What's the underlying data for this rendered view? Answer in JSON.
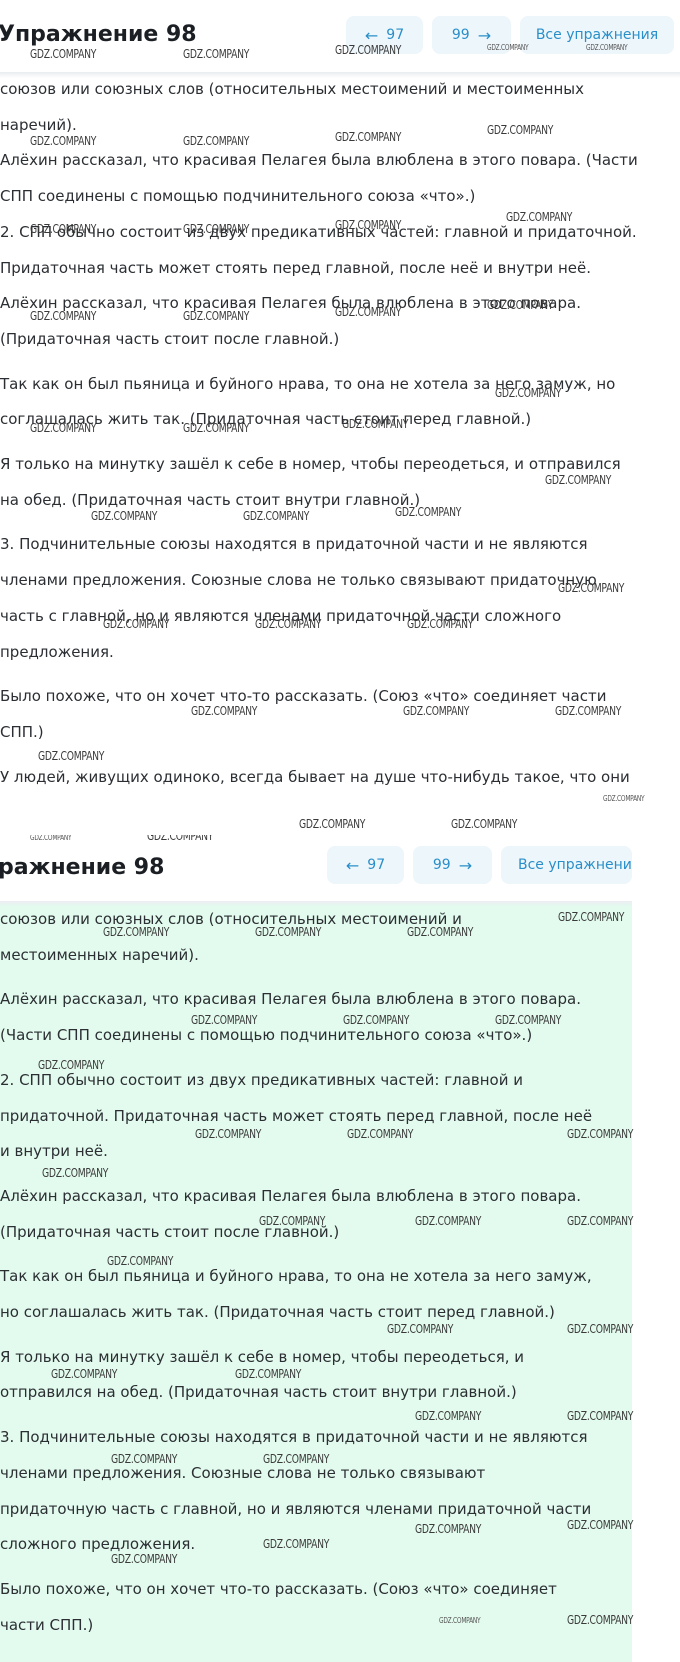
{
  "page": {
    "title": "Упражнение 98",
    "title_cut": "ражнение 98",
    "prev_label": "97",
    "next_label": "99",
    "all_label": "Все упражнения",
    "all_label_cut": "Все упражнени",
    "prev_icon": "arrow-left-icon",
    "next_icon": "arrow-right-icon",
    "accent_color": "#2a8fc9",
    "button_bg": "#edf6fb",
    "highlight_bg": "#e3fbee"
  },
  "watermark": "GDZ.COMPANY",
  "panel1_lines": [
    "союзов или союзных слов (относительных местоимений и местоименных",
    "наречий).",
    "Алёхин рассказал, что красивая Пелагея была влюблена в этого повара. (Части",
    "СПП соединены с помощью подчинительного союза «что».)",
    "2. СПП обычно состоит из двух предикативных частей: главной и придаточной.",
    "Придаточная часть может стоять перед главной, после неё и внутри неё.",
    "Алёхин рассказал, что красивая Пелагея была влюблена в этого повара.",
    "(Придаточная часть стоит после главной.)",
    "Так как он был пьяница и буйного нрава, то она не хотела за него замуж, но",
    "соглашалась жить так. (Придаточная часть стоит перед главной.)",
    "Я только на минутку зашёл к себе в номер, чтобы переодеться, и отправился",
    "на обед. (Придаточная часть стоит внутри главной.)",
    "3. Подчинительные союзы находятся в придаточной части и не являются",
    "членами предложения. Союзные слова не только связывают придаточную",
    "часть с главной, но и являются членами придаточной части сложного",
    "предложения.",
    "Было похоже, что он хочет что-то рассказать. (Союз «что» соединяет части",
    "СПП.)",
    "У людей, живущих одиноко, всегда бывает на душе что-нибудь такое, что они"
  ],
  "panel2_lines": [
    "союзов или союзных слов (относительных местоимений и",
    "местоименных наречий).",
    "Алёхин рассказал, что красивая Пелагея была влюблена в этого повара.",
    "(Части СПП соединены с помощью подчинительного союза «что».)",
    "2. СПП обычно состоит из двух предикативных частей: главной и",
    "придаточной. Придаточная часть может стоять перед главной, после неё",
    "и внутри неё.",
    "Алёхин рассказал, что красивая Пелагея была влюблена в этого повара.",
    "(Придаточная часть стоит после главной.)",
    "Так как он был пьяница и буйного нрава, то она не хотела за него замуж,",
    "но соглашалась жить так. (Придаточная часть стоит перед главной.)",
    "Я только на минутку зашёл к себе в номер, чтобы переодеться, и",
    "отправился на обед. (Придаточная часть стоит внутри главной.)",
    "3. Подчинительные союзы находятся в придаточной части и не являются",
    "членами предложения. Союзные слова не только связывают",
    "придаточную часть с главной, но и являются членами придаточной части",
    "сложного предложения.",
    "Было похоже, что он хочет что-то рассказать. (Союз «что» соединяет",
    "части СПП.)"
  ]
}
